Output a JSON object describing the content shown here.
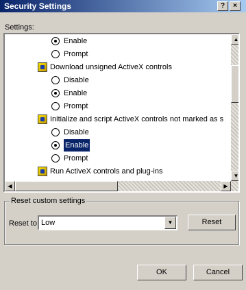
{
  "window": {
    "title": "Security Settings",
    "help_glyph": "?",
    "close_glyph": "×"
  },
  "settings_label": "Settings:",
  "list": {
    "items": [
      {
        "type": "radio",
        "label": "Enable",
        "checked": true,
        "selected": false
      },
      {
        "type": "radio",
        "label": "Prompt",
        "checked": false,
        "selected": false
      },
      {
        "type": "group",
        "label": "Download unsigned ActiveX controls"
      },
      {
        "type": "radio",
        "label": "Disable",
        "checked": false,
        "selected": false
      },
      {
        "type": "radio",
        "label": "Enable",
        "checked": true,
        "selected": false
      },
      {
        "type": "radio",
        "label": "Prompt",
        "checked": false,
        "selected": false
      },
      {
        "type": "group",
        "label": "Initialize and script ActiveX controls not marked as s"
      },
      {
        "type": "radio",
        "label": "Disable",
        "checked": false,
        "selected": false
      },
      {
        "type": "radio",
        "label": "Enable",
        "checked": true,
        "selected": true
      },
      {
        "type": "radio",
        "label": "Prompt",
        "checked": false,
        "selected": false
      },
      {
        "type": "group",
        "label": "Run ActiveX controls and plug-ins"
      }
    ]
  },
  "reset": {
    "legend": "Reset custom settings",
    "reset_to_label": "Reset to:",
    "selected_value": "Low",
    "reset_button": "Reset"
  },
  "buttons": {
    "ok": "OK",
    "cancel": "Cancel"
  }
}
